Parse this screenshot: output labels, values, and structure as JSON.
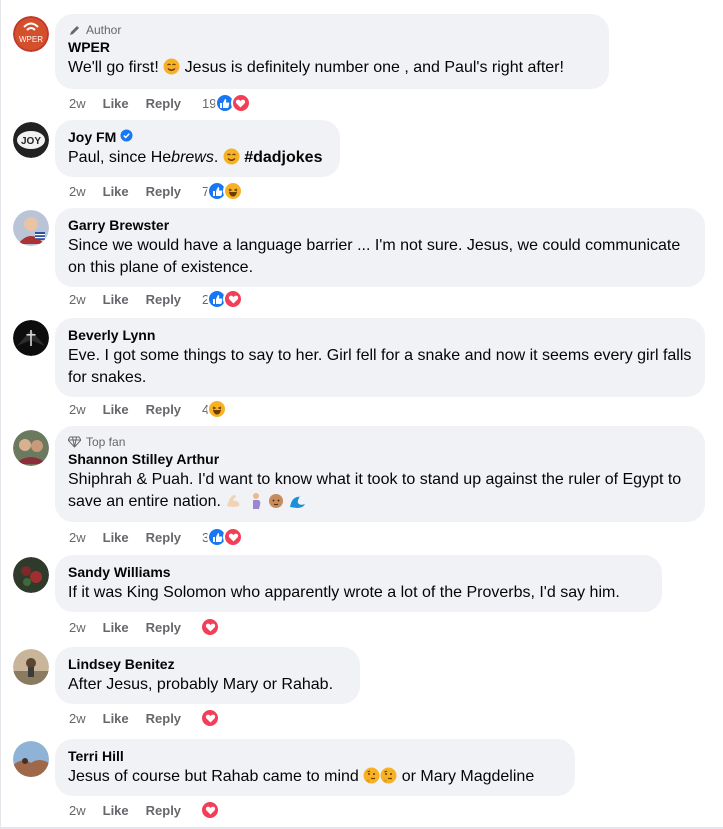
{
  "colors": {
    "like": "#1877f2",
    "love": "#f33e58",
    "haha": "#f7b125",
    "bubble": "#f0f2f5",
    "meta": "#65676b"
  },
  "actions": {
    "like_label": "Like",
    "reply_label": "Reply"
  },
  "comments": [
    {
      "badge": "Author",
      "badge_icon": "pencil-icon",
      "name": "WPER",
      "avatar_text": "WPER",
      "text_a": "We'll go first! ",
      "emoji_a": "smile",
      "text_b": " Jesus is definitely number one , and Paul's right after!",
      "time": "2w",
      "reaction_count": "19",
      "reactions": [
        "like",
        "love"
      ]
    },
    {
      "name": "Joy FM",
      "verified": true,
      "avatar_text": "JOY",
      "text_a": "Paul, since He",
      "text_ital": "brews",
      "text_b": ". ",
      "emoji_a": "smile",
      "hashtag": "#dadjokes",
      "time": "2w",
      "reaction_count": "7",
      "reactions": [
        "like",
        "haha"
      ]
    },
    {
      "name": "Garry Brewster",
      "text_a": "Since we would have a language barrier ... I'm not sure. Jesus, we could communicate on this plane of existence.",
      "time": "2w",
      "reaction_count": "2",
      "reactions": [
        "like",
        "love"
      ]
    },
    {
      "name": "Beverly Lynn",
      "text_a": "Eve. I got some things to say to her. Girl fell for a snake and now it seems every girl falls for snakes.",
      "time": "2w",
      "reaction_count": "4",
      "reactions": [
        "haha"
      ]
    },
    {
      "badge": "Top fan",
      "badge_icon": "diamond-icon",
      "name": "Shannon Stilley Arthur",
      "text_a": "Shiphrah & Puah. I'd want to know what it took to stand up against the ruler of Egypt to save an entire nation. ",
      "emojis": [
        "flexed-biceps",
        "pregnant-woman",
        "baby",
        "water-wave"
      ],
      "time": "2w",
      "reaction_count": "3",
      "reactions": [
        "like",
        "love"
      ]
    },
    {
      "name": "Sandy Williams",
      "text_a": "If it was King Solomon who apparently wrote a lot of the Proverbs, I'd say him.",
      "time": "2w",
      "reaction_count": "",
      "reactions": [
        "love"
      ]
    },
    {
      "name": "Lindsey Benitez",
      "text_a": "After Jesus, probably Mary or Rahab.",
      "time": "2w",
      "reaction_count": "",
      "reactions": [
        "love"
      ]
    },
    {
      "name": "Terri Hill",
      "text_a": "Jesus of course but Rahab came to mind ",
      "emojis": [
        "thinking-face",
        "thinking-face"
      ],
      "text_b": " or Mary Magdeline",
      "time": "2w",
      "reaction_count": "",
      "reactions": [
        "love"
      ]
    }
  ]
}
